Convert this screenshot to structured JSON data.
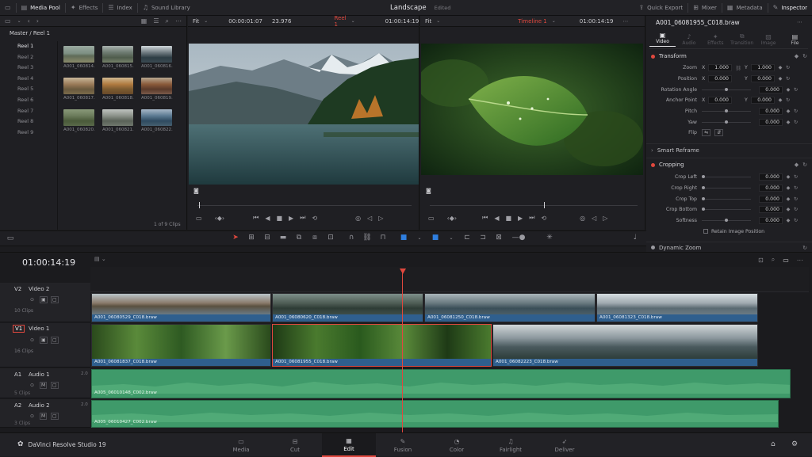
{
  "topbar": {
    "left_tabs": [
      {
        "label": "Media Pool",
        "icon": "media-pool-icon",
        "active": true
      },
      {
        "label": "Effects",
        "icon": "effects-icon",
        "active": false
      },
      {
        "label": "Index",
        "icon": "index-icon",
        "active": false
      },
      {
        "label": "Sound Library",
        "icon": "sound-library-icon",
        "active": false
      }
    ],
    "project_title": "Landscape",
    "project_status": "Edited",
    "right_tabs": [
      {
        "label": "Quick Export",
        "icon": "quick-export-icon"
      },
      {
        "label": "Mixer",
        "icon": "mixer-icon"
      },
      {
        "label": "Metadata",
        "icon": "metadata-icon"
      },
      {
        "label": "Inspector",
        "icon": "inspector-icon"
      }
    ]
  },
  "source_viewer": {
    "zoom": "Fit",
    "timecode": "00:00:01:07",
    "fps": "23.976",
    "reel": "Reel 1",
    "duration": "01:00:14:19"
  },
  "timeline_viewer": {
    "zoom": "Fit",
    "timeline_name": "Timeline 1",
    "timecode": "01:00:14:19"
  },
  "media_pool": {
    "breadcrumb": "Master / Reel 1",
    "reels": [
      "Reel 1",
      "Reel 2",
      "Reel 3",
      "Reel 4",
      "Reel 5",
      "Reel 6",
      "Reel 7",
      "Reel 8",
      "Reel 9"
    ],
    "clips": [
      "A001_060814...",
      "A001_060815...",
      "A001_060816...",
      "A001_060817...",
      "A001_060818...",
      "A001_060819...",
      "A001_060820...",
      "A001_060821...",
      "A001_060822..."
    ],
    "clip_count": "1 of 9 Clips"
  },
  "inspector": {
    "clip_name": "A001_06081955_C018.braw",
    "tabs": [
      "Video",
      "Audio",
      "Effects",
      "Transition",
      "Image",
      "File"
    ],
    "transform_title": "Transform",
    "zoom": {
      "label": "Zoom",
      "x": "1.000",
      "y": "1.000"
    },
    "position": {
      "label": "Position",
      "x": "0.000",
      "y": "0.000"
    },
    "rotation": {
      "label": "Rotation Angle",
      "value": "0.000"
    },
    "anchor": {
      "label": "Anchor Point",
      "x": "0.000",
      "y": "0.000"
    },
    "pitch": {
      "label": "Pitch",
      "value": "0.000"
    },
    "yaw": {
      "label": "Yaw",
      "value": "0.000"
    },
    "flip_label": "Flip",
    "axis_x": "X",
    "axis_y": "Y",
    "smart_reframe": "Smart Reframe",
    "cropping_title": "Cropping",
    "crop_left": {
      "label": "Crop Left",
      "value": "0.000"
    },
    "crop_right": {
      "label": "Crop Right",
      "value": "0.000"
    },
    "crop_top": {
      "label": "Crop Top",
      "value": "0.000"
    },
    "crop_bottom": {
      "label": "Crop Bottom",
      "value": "0.000"
    },
    "softness": {
      "label": "Softness",
      "value": "0.000"
    },
    "retain_label": "Retain Image Position",
    "dynamic_zoom": "Dynamic Zoom"
  },
  "timeline": {
    "timecode": "01:00:14:19",
    "tracks": [
      {
        "id": "V2",
        "name": "Video 2",
        "count": "10 Clips"
      },
      {
        "id": "V1",
        "name": "Video 1",
        "count": "16 Clips"
      },
      {
        "id": "A1",
        "name": "Audio 1",
        "count": "5 Clips",
        "level": "2.0"
      },
      {
        "id": "A2",
        "name": "Audio 2",
        "count": "3 Clips",
        "level": "2.0"
      }
    ],
    "v2_clips": [
      "A001_06080529_C018.braw",
      "A001_06080620_C018.braw",
      "A001_06081250_C018.braw",
      "A001_06081323_C018.braw"
    ],
    "v1_clips": [
      "A001_06081837_C018.braw",
      "A001_06081955_C018.braw",
      "A001_06082223_C018.braw"
    ],
    "a1_clip": "A005_06010148_C002.braw",
    "a2_clip": "A005_06010427_C002.braw"
  },
  "footer": {
    "app_name": "DaVinci Resolve Studio 19",
    "pages": [
      {
        "label": "Media",
        "icon": "media-page-icon",
        "active": false
      },
      {
        "label": "Cut",
        "icon": "cut-page-icon",
        "active": false
      },
      {
        "label": "Edit",
        "icon": "edit-page-icon",
        "active": true
      },
      {
        "label": "Fusion",
        "icon": "fusion-page-icon",
        "active": false
      },
      {
        "label": "Color",
        "icon": "color-page-icon",
        "active": false
      },
      {
        "label": "Fairlight",
        "icon": "fairlight-page-icon",
        "active": false
      },
      {
        "label": "Deliver",
        "icon": "deliver-page-icon",
        "active": false
      }
    ]
  },
  "colors": {
    "accent_red": "#e0483e",
    "video_clip": "#2f5f8e",
    "audio_clip": "#3f9a6a"
  }
}
